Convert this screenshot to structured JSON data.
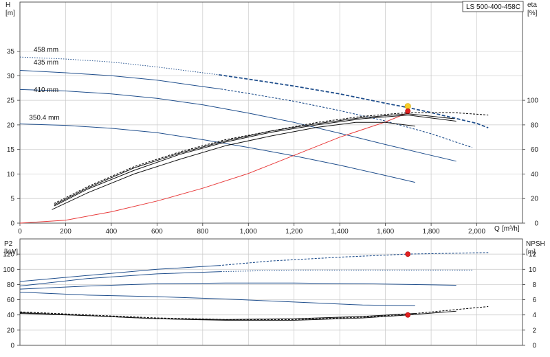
{
  "model": "LS 500-400-458C",
  "colors": {
    "curve_blue": "#1f4e8c",
    "curve_black": "#111111",
    "system_red": "#e83a3a",
    "marker_red": "#e02020",
    "marker_yellow": "#f7d02c",
    "grid": "#c8c8c8"
  },
  "chart_data": [
    {
      "type": "line",
      "panel": "top",
      "xlabel": "Q",
      "xunit": "[m³/h]",
      "xlim": [
        0,
        2200
      ],
      "xticks": [
        0,
        200,
        400,
        600,
        800,
        1000,
        1200,
        1400,
        1600,
        1800,
        2000
      ],
      "xtick_labels": [
        "0",
        "200",
        "400",
        "600",
        "800",
        "1,000",
        "1,200",
        "1,400",
        "1,600",
        "1,800",
        "2,000"
      ],
      "ylabel": "H",
      "yunit": "[m]",
      "ylim": [
        0,
        45
      ],
      "yticks": [
        0,
        5,
        10,
        15,
        20,
        25,
        30,
        35
      ],
      "ylabel_right": "eta",
      "yunit_right": "[%]",
      "ylim_right": [
        0,
        180
      ],
      "yticks_right": [
        0,
        20,
        40,
        60,
        80,
        100
      ],
      "grid": true,
      "series": [
        {
          "name": "458 mm",
          "axis": "left",
          "color": "blue",
          "style": "dotted",
          "x": [
            0,
            200,
            400,
            600,
            800,
            870
          ],
          "y": [
            33.8,
            33.4,
            32.8,
            31.8,
            30.6,
            30.2
          ]
        },
        {
          "name": "",
          "axis": "left",
          "color": "blue",
          "style": "dashed-thick",
          "x": [
            870,
            1000,
            1200,
            1400,
            1600,
            1700,
            1800,
            2000,
            2050
          ],
          "y": [
            30.2,
            29.3,
            27.9,
            26.3,
            24.4,
            23.5,
            22.5,
            20.3,
            19.4
          ]
        },
        {
          "name": "435 mm",
          "axis": "left",
          "color": "blue",
          "style": "solid",
          "x": [
            0,
            200,
            400,
            600,
            800,
            880
          ],
          "y": [
            31.1,
            30.6,
            30.0,
            29.1,
            27.8,
            27.3
          ]
        },
        {
          "name": "",
          "axis": "left",
          "color": "blue",
          "style": "dashed",
          "x": [
            880,
            1000,
            1200,
            1400,
            1600,
            1800,
            1980
          ],
          "y": [
            27.3,
            26.4,
            24.8,
            22.9,
            20.8,
            18.2,
            15.4
          ]
        },
        {
          "name": "410 mm",
          "axis": "left",
          "color": "blue",
          "style": "solid",
          "x": [
            0,
            200,
            400,
            600,
            800,
            1000,
            1200,
            1400,
            1600,
            1800,
            1910
          ],
          "y": [
            27.2,
            26.9,
            26.3,
            25.4,
            24.1,
            22.4,
            20.5,
            18.3,
            16.0,
            13.8,
            12.6
          ]
        },
        {
          "name": "350.4 mm",
          "axis": "left",
          "color": "blue",
          "style": "solid",
          "x": [
            0,
            200,
            400,
            600,
            800,
            1000,
            1200,
            1400,
            1600,
            1730
          ],
          "y": [
            20.2,
            19.9,
            19.3,
            18.4,
            17.0,
            15.4,
            13.7,
            11.8,
            9.7,
            8.3
          ]
        },
        {
          "name": "",
          "axis": "left",
          "color": "red",
          "style": "solid",
          "x": [
            0,
            200,
            400,
            600,
            800,
            1000,
            1200,
            1400,
            1600,
            1700
          ],
          "y": [
            0,
            0.6,
            2.3,
            4.5,
            7.1,
            10.1,
            13.8,
            17.5,
            20.6,
            22.5
          ]
        },
        {
          "name": "",
          "axis": "right",
          "color": "black",
          "style": "dashed",
          "x": [
            150,
            300,
            500,
            700,
            900,
            1100,
            1300,
            1500,
            1700,
            1900,
            2050
          ],
          "y": [
            16,
            30,
            46,
            58,
            68,
            75,
            82,
            87,
            90,
            90,
            88
          ]
        },
        {
          "name": "",
          "axis": "right",
          "color": "black",
          "style": "solid",
          "x": [
            150,
            300,
            500,
            700,
            900,
            1100,
            1300,
            1500,
            1700,
            1900
          ],
          "y": [
            15,
            29,
            45,
            57,
            67,
            75,
            81,
            86,
            89,
            85
          ]
        },
        {
          "name": "",
          "axis": "right",
          "color": "black",
          "style": "solid",
          "x": [
            150,
            300,
            500,
            700,
            900,
            1100,
            1300,
            1500,
            1700,
            1910
          ],
          "y": [
            14,
            28,
            43,
            56,
            66,
            74,
            80,
            85,
            88,
            83
          ]
        },
        {
          "name": "",
          "axis": "right",
          "color": "black",
          "style": "solid",
          "x": [
            140,
            300,
            500,
            700,
            900,
            1100,
            1300,
            1470,
            1600,
            1730
          ],
          "y": [
            11,
            25,
            40,
            52,
            63,
            71,
            78,
            82,
            82,
            79
          ]
        }
      ],
      "points": [
        {
          "x": 1698,
          "y": 23.8,
          "axis": "left",
          "color": "yellow"
        },
        {
          "x": 1698,
          "y": 22.8,
          "axis": "left",
          "color": "red"
        }
      ],
      "labels": [
        {
          "text": "458 mm",
          "x": 60,
          "y": 34.9
        },
        {
          "text": "435 mm",
          "x": 60,
          "y": 32.3
        },
        {
          "text": "410 mm",
          "x": 60,
          "y": 26.7
        },
        {
          "text": "350.4 mm",
          "x": 40,
          "y": 21.0
        }
      ]
    },
    {
      "type": "line",
      "panel": "bottom",
      "xlim": [
        0,
        2200
      ],
      "ylabel": "P2",
      "yunit": "[kW]",
      "ylim": [
        0,
        140
      ],
      "yticks": [
        0,
        20,
        40,
        60,
        80,
        100,
        120
      ],
      "ylabel_right": "NPSH",
      "yunit_right": "[m]",
      "ylim_right": [
        0,
        14
      ],
      "yticks_right": [
        0,
        2,
        4,
        6,
        8,
        10,
        12
      ],
      "grid": true,
      "series": [
        {
          "name": "",
          "axis": "left",
          "color": "blue",
          "style": "solid",
          "x": [
            0,
            300,
            600,
            870
          ],
          "y": [
            84,
            92,
            100,
            105
          ]
        },
        {
          "name": "",
          "axis": "left",
          "color": "blue",
          "style": "dashed",
          "x": [
            870,
            1100,
            1400,
            1700,
            2050
          ],
          "y": [
            105,
            111,
            116,
            120,
            122
          ]
        },
        {
          "name": "",
          "axis": "left",
          "color": "blue",
          "style": "solid",
          "x": [
            0,
            300,
            600,
            880
          ],
          "y": [
            78,
            88,
            94,
            97
          ]
        },
        {
          "name": "",
          "axis": "left",
          "color": "blue",
          "style": "dotted",
          "x": [
            880,
            1200,
            1500,
            1800,
            1980
          ],
          "y": [
            97,
            99,
            99,
            99,
            99
          ]
        },
        {
          "name": "",
          "axis": "left",
          "color": "blue",
          "style": "solid",
          "x": [
            0,
            300,
            600,
            900,
            1200,
            1500,
            1910
          ],
          "y": [
            74,
            78,
            81,
            82,
            82,
            81,
            79
          ]
        },
        {
          "name": "",
          "axis": "left",
          "color": "blue",
          "style": "solid",
          "x": [
            0,
            300,
            600,
            900,
            1200,
            1500,
            1730
          ],
          "y": [
            70,
            66,
            64,
            61,
            57,
            53,
            52
          ]
        },
        {
          "name": "",
          "axis": "right",
          "color": "black",
          "style": "dashed",
          "x": [
            0,
            300,
            600,
            900,
            1200,
            1500,
            1700,
            2050
          ],
          "y": [
            4.4,
            4.0,
            3.6,
            3.4,
            3.4,
            3.7,
            4.1,
            5.1
          ]
        },
        {
          "name": "",
          "axis": "right",
          "color": "black",
          "style": "solid",
          "x": [
            0,
            300,
            600,
            900,
            1200,
            1500,
            1700,
            1910
          ],
          "y": [
            4.2,
            3.9,
            3.5,
            3.3,
            3.3,
            3.6,
            4.0,
            4.5
          ]
        },
        {
          "name": "",
          "axis": "right",
          "color": "black",
          "style": "solid",
          "x": [
            0,
            300,
            600,
            900,
            1200,
            1500,
            1730
          ],
          "y": [
            4.3,
            3.9,
            3.5,
            3.4,
            3.5,
            3.8,
            4.2
          ]
        }
      ],
      "points": [
        {
          "x": 1698,
          "y": 120,
          "axis": "left",
          "color": "red"
        },
        {
          "x": 1698,
          "y": 4.0,
          "axis": "right",
          "color": "red"
        }
      ]
    }
  ]
}
